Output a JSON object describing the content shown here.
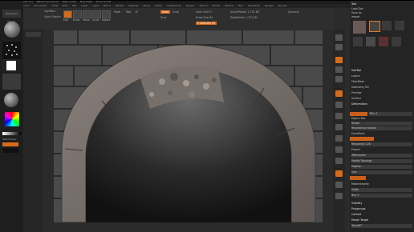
{
  "titlebar": {
    "items": [
      "ZBrush 4R2",
      "[DirectX 11]",
      "ZBrush Document",
      "Mem 4.152",
      "Free 2899",
      "Timer 0.176"
    ]
  },
  "menubar": {
    "items": [
      "Alpha",
      "Brush",
      "Color",
      "Document",
      "Draw",
      "Edit",
      "File",
      "Layer",
      "Light",
      "Macro",
      "Marker",
      "Material",
      "Movie",
      "Picker",
      "Preferences",
      "Render",
      "Stencil",
      "Stroke",
      "Texture",
      "Tool",
      "Transform",
      "Zplugin",
      "Zscript"
    ]
  },
  "shelf": {
    "projection_master": "Projection Master",
    "lightbox": "LightBox",
    "quick_sketch": "Quick Sketch",
    "edit": "Edit",
    "draw": "Draw",
    "move": "Move",
    "scale": "Scale",
    "rotate": "Rotate",
    "mrgb": "Mrgb",
    "rgb": "Rgb",
    "m": "M",
    "zadd": "Zadd",
    "zsub": "Zsub",
    "zcut": "Zcut",
    "focal_shift": "Focal Shift 0",
    "draw_size": "Draw Size 64",
    "z_intensity": "Z Intensity 25",
    "rgb_intensity": "Rgb Intensity 100",
    "active_points": "ActivePoints: 1.751 Mil",
    "total_points": "TotalPoints: 1.751 Mil",
    "dynamic": "Dynamic"
  },
  "left": {
    "texture_off": "Texture Off",
    "alpha_off": "Alpha Off",
    "material": "MatCap",
    "gradient": "Gradient",
    "switch_color": "SwitchColor"
  },
  "panel": {
    "title": "Tool",
    "items": [
      "Load Tool",
      "Save As",
      "Import",
      "Export",
      "Clone",
      "Make PolyMesh3D",
      "GoZ",
      "All",
      "Visible",
      "R",
      "Lightbox ▸ Tools",
      "SubTool",
      "Layers",
      "FiberMesh",
      "Geometry HD",
      "Preview",
      "Surface",
      "Deformation",
      "Masking",
      "Visibility",
      "Polygroups",
      "Contact",
      "Morph Target",
      "Polypaint",
      "UV Map",
      "Texture Map",
      "Displacement Map",
      "Normal Map",
      "Vector Displacement Map",
      "Display Properties",
      "Unified Skin",
      "Initialize",
      "Import",
      "Export"
    ],
    "sdiv": "SDiv 5",
    "lower_res": "Lower Res",
    "higher_res": "Higher Res",
    "divide": "Divide",
    "smt": "Smt",
    "suv": "Suv",
    "reuv": "ReUV",
    "del_lower": "Del Lower",
    "del_higher": "Del Higher",
    "reconstruct": "Reconstruct Subdiv",
    "dynamesh": "DynaMesh",
    "groups": "Groups",
    "polish": "Polish",
    "blur": "Blur 2",
    "resolution": "Resolution 128",
    "project": "Project",
    "zremesher": "ZRemesher",
    "modify_topology": "Modify Topology",
    "position": "Position",
    "size": "Size",
    "meshintegrity": "MeshIntegrity",
    "visibility": "Visibility",
    "polygroups": "Polygroups",
    "contact": "Contact",
    "morph_target": "Morph Target",
    "edit_btn": "Edit",
    "storemt": "StoreMT"
  },
  "colors": {
    "accent": "#d86b1a",
    "stone": "#6f6864",
    "wall": "#4a4a4a"
  }
}
